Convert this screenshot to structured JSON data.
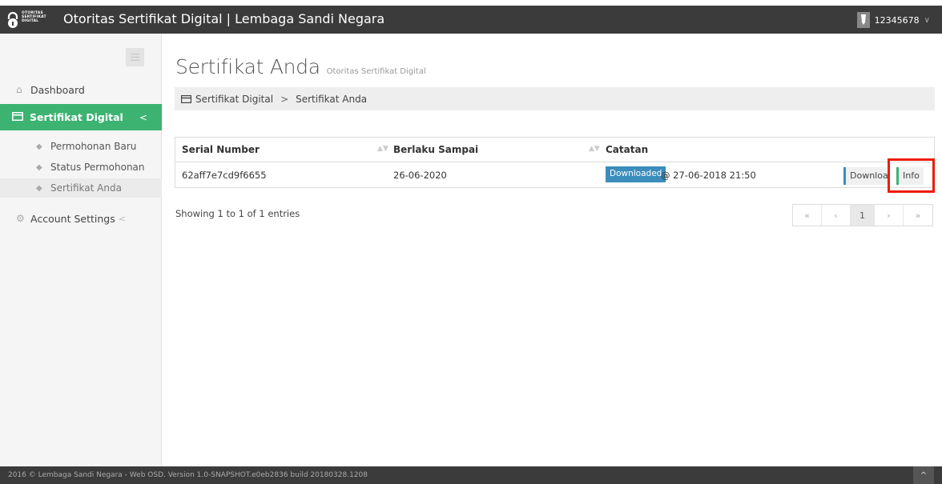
{
  "app": {
    "title": "Otoritas Sertifikat Digital | Lembaga Sandi Negara",
    "logo_text": [
      "OTORITAS",
      "SERTIFIKAT",
      "DIGITAL"
    ],
    "user_id": "12345678",
    "user_caret": "∨"
  },
  "sidebar": {
    "dashboard": "Dashboard",
    "sertifikat_digital": "Sertifikat Digital",
    "sertifikat_chevron": "<",
    "sub_items": [
      "Permohonan Baru",
      "Status Permohonan",
      "Sertifikat Anda"
    ],
    "account_settings": "Account Settings",
    "account_chevron": "<"
  },
  "page": {
    "title": "Sertifikat Anda",
    "subtitle": "Otoritas Sertifikat Digital",
    "breadcrumb": [
      "Sertifikat Digital",
      "Sertifikat Anda"
    ],
    "breadcrumb_sep": ">"
  },
  "table": {
    "columns": [
      "Serial Number",
      "Berlaku Sampai",
      "Catatan"
    ],
    "rows": [
      {
        "serial": "62aff7e7cd9f6655",
        "berlaku": "26-06-2020",
        "status_label": "Downloaded",
        "catatan": "@ 27-06-2018 21:50",
        "download_button": "Download",
        "info_button": "Info"
      }
    ]
  },
  "pagination": {
    "showing": "Showing 1 to 1 of 1 entries",
    "first": "«",
    "prev": "‹",
    "current": "1",
    "next": "›",
    "last": "»"
  },
  "footer": {
    "text": "2016 © Lembaga Sandi Negara - Web OSD. Version 1.0-SNAPSHOT.e0eb2836 build 20180328.1208",
    "scroll_top": "^"
  },
  "colors": {
    "accent_green": "#3cb371",
    "label_blue": "#3c8dbc",
    "topbar": "#3b3b3b",
    "highlight_red": "#ee1c0a"
  }
}
